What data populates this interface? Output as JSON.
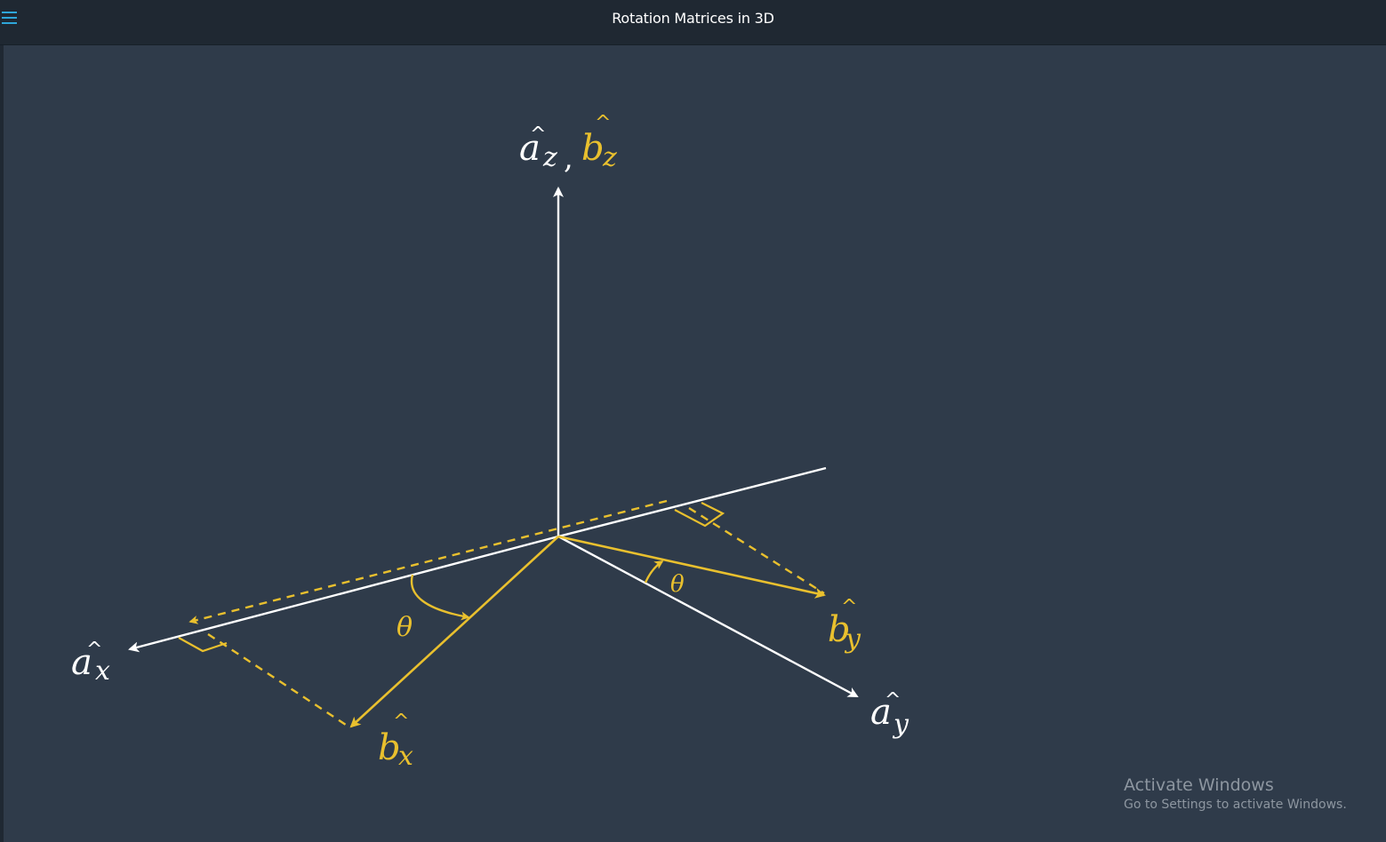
{
  "header": {
    "title": "Rotation Matrices in 3D",
    "menu_icon": "hamburger-menu-icon"
  },
  "diagram": {
    "colors": {
      "background": "#2f3b4a",
      "frame_a": "#ffffff",
      "frame_b": "#e9c02e",
      "menu_accent": "#2ea6d9"
    },
    "labels": {
      "az_a": "a",
      "az_sub": "z",
      "comma": ",",
      "bz_b": "b",
      "bz_sub": "z",
      "ax_a": "a",
      "ax_sub": "x",
      "ay_a": "a",
      "ay_sub": "y",
      "bx_b": "b",
      "bx_sub": "x",
      "by_b": "b",
      "by_sub": "y",
      "hat": "^",
      "theta_x": "θ",
      "theta_y": "θ"
    }
  },
  "watermark": {
    "title": "Activate Windows",
    "subtitle": "Go to Settings to activate Windows."
  }
}
